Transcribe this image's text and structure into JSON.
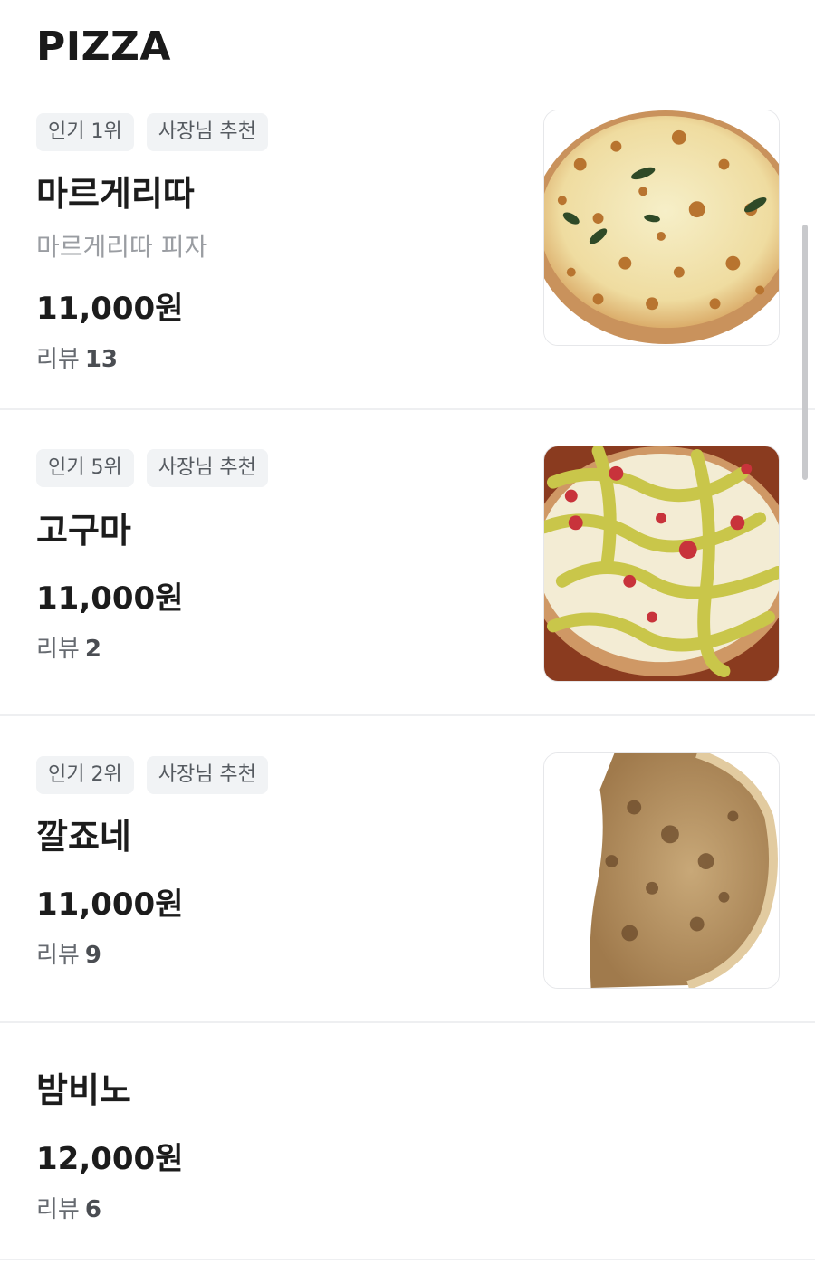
{
  "section": {
    "title": "PIZZA"
  },
  "menu_items": [
    {
      "badges": [
        "인기 1위",
        "사장님 추천"
      ],
      "name": "마르게리따",
      "description": "마르게리따 피자",
      "price": "11,000원",
      "review_label": "리뷰",
      "review_count": "13",
      "image_icon": "margherita-pizza-photo"
    },
    {
      "badges": [
        "인기 5위",
        "사장님 추천"
      ],
      "name": "고구마",
      "price": "11,000원",
      "review_label": "리뷰",
      "review_count": "2",
      "image_icon": "sweet-potato-pizza-photo"
    },
    {
      "badges": [
        "인기 2위",
        "사장님 추천"
      ],
      "name": "깔죠네",
      "price": "11,000원",
      "review_label": "리뷰",
      "review_count": "9",
      "image_icon": "calzone-photo"
    },
    {
      "name": "밤비노",
      "price": "12,000원",
      "review_label": "리뷰",
      "review_count": "6"
    }
  ],
  "colors": {
    "badge_bg": "#f1f3f5",
    "badge_text": "#555a60",
    "divider": "#eeeff1",
    "description": "#9a9da2"
  }
}
